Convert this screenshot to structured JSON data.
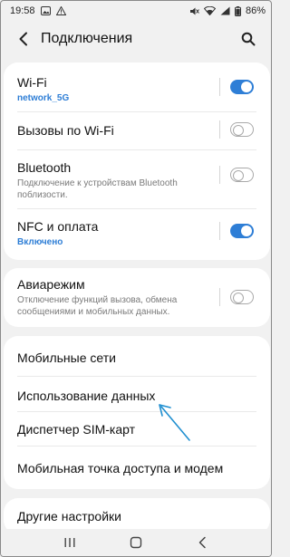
{
  "status_bar": {
    "time": "19:58",
    "battery": "86%",
    "left_icons": [
      "gallery-icon",
      "warning-icon"
    ],
    "right_icons": [
      "mute-icon",
      "wifi-icon",
      "signal-icon",
      "battery-icon"
    ]
  },
  "header": {
    "title": "Подключения",
    "back_icon": "back-arrow-icon",
    "search_icon": "search-icon"
  },
  "groups": [
    {
      "items": [
        {
          "title": "Wi-Fi",
          "subtitle": "network_5G",
          "subtitle_accent": true,
          "toggle": true
        },
        {
          "title": "Вызовы по Wi-Fi",
          "subtitle": "",
          "toggle": false
        },
        {
          "title": "Bluetooth",
          "subtitle": "Подключение к устройствам Bluetooth поблизости.",
          "toggle": false
        },
        {
          "title": "NFC и оплата",
          "subtitle": "Включено",
          "subtitle_accent": true,
          "toggle": true
        }
      ]
    },
    {
      "items": [
        {
          "title": "Авиарежим",
          "subtitle": "Отключение функций вызова, обмена сообщениями и мобильных данных.",
          "toggle": false
        }
      ]
    },
    {
      "items": [
        {
          "title": "Мобильные сети"
        },
        {
          "title": "Использование данных"
        },
        {
          "title": "Диспетчер SIM-карт"
        },
        {
          "title": "Мобильная точка доступа и модем"
        }
      ]
    },
    {
      "items": [
        {
          "title": "Другие настройки"
        }
      ]
    }
  ],
  "annotation": {
    "arrow_icon": "pointer-arrow-icon",
    "color": "#1f8fd0"
  },
  "nav_bar": {
    "icons": [
      "recents-icon",
      "home-icon",
      "back-icon"
    ]
  },
  "colors": {
    "accent": "#2e7ed6",
    "background": "#f1f1f1",
    "card": "#ffffff"
  }
}
